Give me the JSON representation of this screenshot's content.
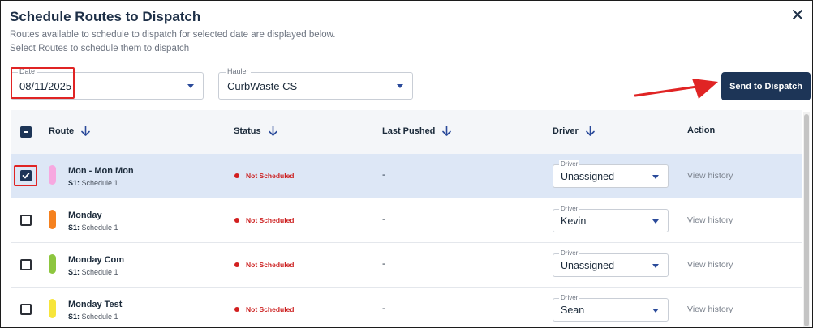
{
  "dialog": {
    "title": "Schedule Routes to Dispatch",
    "subtitle_line1": "Routes available to schedule to dispatch for selected date are displayed below.",
    "subtitle_line2": "Select Routes to schedule them to dispatch"
  },
  "filters": {
    "date": {
      "label": "Date",
      "value": "08/11/2025"
    },
    "hauler": {
      "label": "Hauler",
      "value": "CurbWaste CS"
    }
  },
  "send_button_label": "Send to Dispatch",
  "table": {
    "headers": {
      "route": "Route",
      "status": "Status",
      "last_pushed": "Last Pushed",
      "driver": "Driver",
      "action": "Action"
    },
    "rows": [
      {
        "name": "Mon - Mon Mon",
        "schedule_prefix": "S1:",
        "schedule": "Schedule 1",
        "color": "#f7a8e0",
        "status": "Not Scheduled",
        "last_pushed": "-",
        "driver_label": "Driver",
        "driver": "Unassigned",
        "action": "View history",
        "selected": true
      },
      {
        "name": "Monday",
        "schedule_prefix": "S1:",
        "schedule": "Schedule 1",
        "color": "#f5811f",
        "status": "Not Scheduled",
        "last_pushed": "-",
        "driver_label": "Driver",
        "driver": "Kevin",
        "action": "View history",
        "selected": false
      },
      {
        "name": "Monday Com",
        "schedule_prefix": "S1:",
        "schedule": "Schedule 1",
        "color": "#8dc63f",
        "status": "Not Scheduled",
        "last_pushed": "-",
        "driver_label": "Driver",
        "driver": "Unassigned",
        "action": "View history",
        "selected": false
      },
      {
        "name": "Monday Test",
        "schedule_prefix": "S1:",
        "schedule": "Schedule 1",
        "color": "#f7e53b",
        "status": "Not Scheduled",
        "last_pushed": "-",
        "driver_label": "Driver",
        "driver": "Sean",
        "action": "View history",
        "selected": false
      }
    ]
  },
  "colors": {
    "primary": "#1d3557",
    "selected_row": "#dde7f6",
    "status_red": "#cc1f1f",
    "annotation_red": "#e02424"
  },
  "icons": {
    "close": "close-icon",
    "sort": "arrow-down-icon",
    "caret": "chevron-down-icon",
    "check": "check-icon",
    "indeterminate": "minus-icon"
  }
}
